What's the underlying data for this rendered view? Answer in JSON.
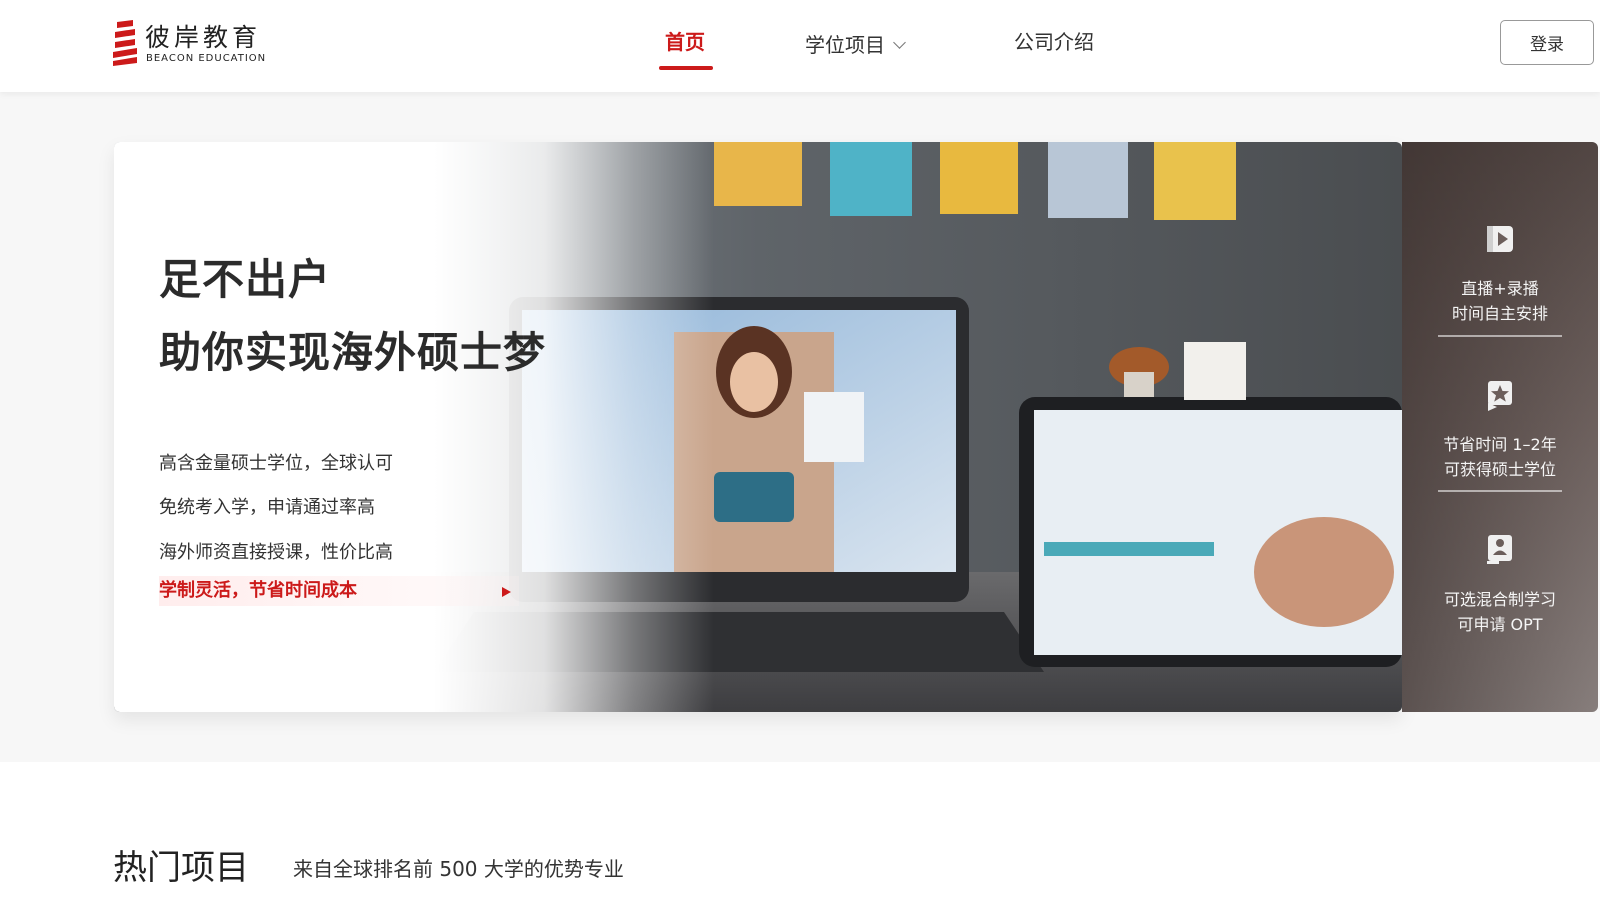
{
  "brand": {
    "name_cn": "彼岸教育",
    "name_en": "BEACON EDUCATION",
    "accent_color": "#cc1a1a"
  },
  "nav": {
    "items": [
      {
        "label": "首页",
        "active": true
      },
      {
        "label": "学位项目",
        "has_dropdown": true
      },
      {
        "label": "公司介绍"
      }
    ],
    "login_label": "登录"
  },
  "hero": {
    "title_line1": "足不出户",
    "title_line2": "助你实现海外硕士梦",
    "features": [
      "高含金量硕士学位，全球认可",
      "免统考入学，申请通过率高",
      "海外师资直接授课，性价比高",
      "学制灵活，节省时间成本"
    ],
    "active_feature_index": 3
  },
  "side_panel": {
    "items": [
      {
        "icon": "video-play-icon",
        "lines": [
          "直播+录播",
          "时间自主安排"
        ]
      },
      {
        "icon": "star-badge-icon",
        "lines": [
          "节省时间 1–2年",
          "可获得硕士学位"
        ]
      },
      {
        "icon": "learner-icon",
        "lines": [
          "可选混合制学习",
          "可申请 OPT"
        ]
      }
    ]
  },
  "hot_section": {
    "title": "热门项目",
    "subtitle": "来自全球排名前 500 大学的优势专业"
  }
}
